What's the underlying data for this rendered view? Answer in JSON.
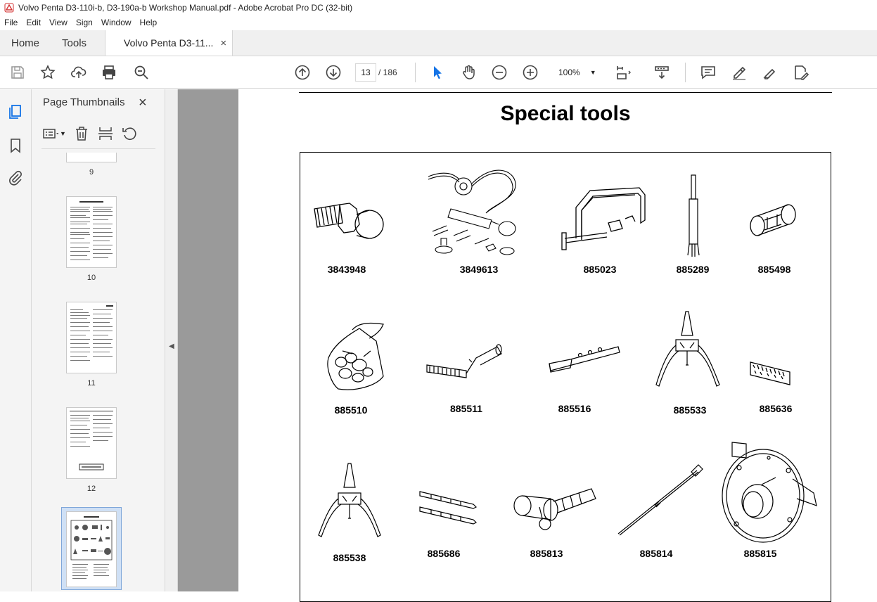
{
  "window": {
    "title": "Volvo Penta D3-110i-b, D3-190a-b Workshop Manual.pdf - Adobe Acrobat Pro DC (32-bit)"
  },
  "menu": [
    "File",
    "Edit",
    "View",
    "Sign",
    "Window",
    "Help"
  ],
  "tabs": {
    "home": "Home",
    "tools": "Tools",
    "document": "Volvo Penta D3-11...",
    "close": "×"
  },
  "toolbar": {
    "current_page": "13",
    "total_pages": "/ 186",
    "zoom": "100%"
  },
  "side_panel": {
    "title": "Page Thumbnails",
    "close": "×",
    "thumbnails": [
      {
        "label": "9"
      },
      {
        "label": "10"
      },
      {
        "label": "11"
      },
      {
        "label": "12"
      },
      {
        "label": "13",
        "selected": true
      }
    ]
  },
  "document": {
    "heading": "Special tools",
    "tools": [
      {
        "number": "3843948",
        "icon": "threaded-adapter-icon"
      },
      {
        "number": "3849613",
        "icon": "pressure-tester-kit-icon"
      },
      {
        "number": "885023",
        "icon": "c-clamp-icon"
      },
      {
        "number": "885289",
        "icon": "drift-icon"
      },
      {
        "number": "885498",
        "icon": "sleeve-icon"
      },
      {
        "number": "885510",
        "icon": "seal-kit-bag-icon"
      },
      {
        "number": "885511",
        "icon": "roller-tool-icon"
      },
      {
        "number": "885516",
        "icon": "flat-key-icon"
      },
      {
        "number": "885533",
        "icon": "puller-icon"
      },
      {
        "number": "885636",
        "icon": "brush-icon"
      },
      {
        "number": "885538",
        "icon": "puller-icon"
      },
      {
        "number": "885686",
        "icon": "guide-pins-icon"
      },
      {
        "number": "885813",
        "icon": "socket-adapter-icon"
      },
      {
        "number": "885814",
        "icon": "long-rod-icon"
      },
      {
        "number": "885815",
        "icon": "fixture-plate-icon"
      }
    ]
  },
  "colors": {
    "accent": "#1473e6",
    "doc_background": "#5b5b5b"
  }
}
